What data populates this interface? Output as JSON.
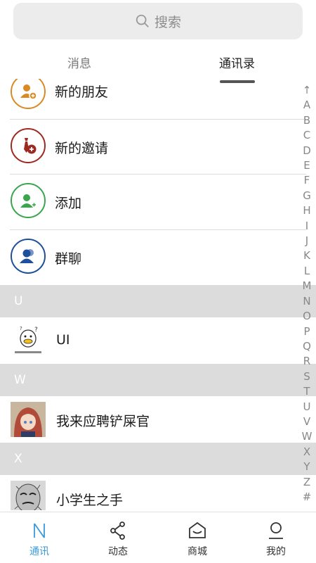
{
  "search": {
    "placeholder": "搜索"
  },
  "tabs": [
    {
      "label": "消息",
      "active": false
    },
    {
      "label": "通讯录",
      "active": true
    }
  ],
  "top_items": [
    {
      "label": "新的朋友",
      "icon": "new-friend-icon",
      "color": "#d98a25"
    },
    {
      "label": "新的邀请",
      "icon": "invitation-icon",
      "color": "#9c2a20"
    },
    {
      "label": "添加",
      "icon": "add-contact-icon",
      "color": "#3aa64b"
    },
    {
      "label": "群聊",
      "icon": "group-chat-icon",
      "color": "#1d4f9c"
    }
  ],
  "sections": [
    {
      "letter": "U",
      "contacts": [
        {
          "name": "UI",
          "avatar": "cartoon-duck-avatar"
        }
      ]
    },
    {
      "letter": "W",
      "contacts": [
        {
          "name": "我来应聘铲屎官",
          "avatar": "anime-girl-avatar"
        }
      ]
    },
    {
      "letter": "X",
      "contacts": [
        {
          "name": "小学生之手",
          "avatar": "meme-face-avatar"
        }
      ]
    }
  ],
  "alphabet": [
    "↑",
    "A",
    "B",
    "C",
    "D",
    "E",
    "F",
    "G",
    "H",
    "I",
    "J",
    "K",
    "L",
    "M",
    "N",
    "O",
    "P",
    "Q",
    "R",
    "S",
    "T",
    "U",
    "V",
    "W",
    "X",
    "Y",
    "Z",
    "#"
  ],
  "bottom_nav": [
    {
      "label": "通讯",
      "icon": "contacts-icon",
      "active": true
    },
    {
      "label": "动态",
      "icon": "share-icon",
      "active": false
    },
    {
      "label": "商城",
      "icon": "mall-icon",
      "active": false
    },
    {
      "label": "我的",
      "icon": "profile-icon",
      "active": false
    }
  ],
  "colors": {
    "accent": "#3a9ad9",
    "section_bg": "#dcdcdc",
    "search_bg": "#ececec"
  }
}
